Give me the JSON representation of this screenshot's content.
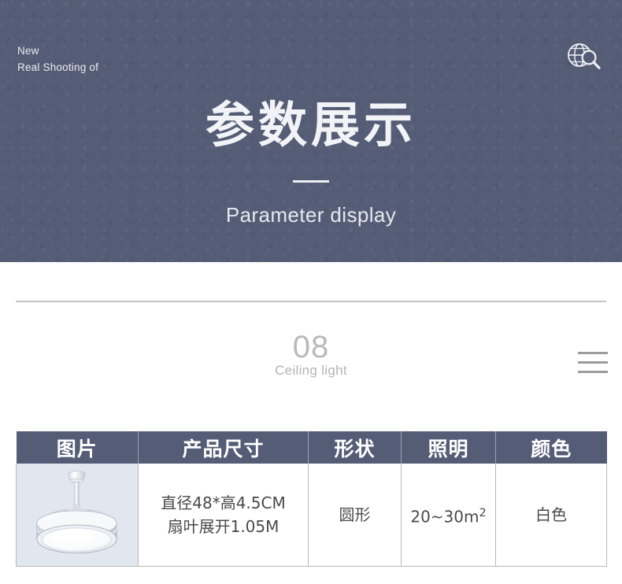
{
  "banner": {
    "corner_line1": "New",
    "corner_line2": "Real Shooting of",
    "icon": "globe-search-icon",
    "title": "参数展示",
    "subtitle": "Parameter display",
    "bg_color": "#555d76",
    "text_color": "#f2f3f6"
  },
  "section": {
    "number": "08",
    "name": "Ceiling light",
    "menu_icon": "hamburger-menu-icon",
    "number_color": "#b9b9b9"
  },
  "table": {
    "headers": [
      {
        "label": "图片"
      },
      {
        "label": "产品尺寸"
      },
      {
        "label": "形状"
      },
      {
        "label": "照明"
      },
      {
        "label": "颜色"
      }
    ],
    "header_bg": "#555d76",
    "image_cell_bg": "#e2e7ef",
    "border_color": "#b9b9b9",
    "rows": [
      {
        "image": "ceiling-fan-light-product-photo",
        "size_line1": "直径48*高4.5CM",
        "size_line2": "扇叶展开1.05M",
        "shape": "圆形",
        "lighting_value": "20~30m",
        "lighting_unit": "2",
        "color": "白色"
      }
    ]
  }
}
